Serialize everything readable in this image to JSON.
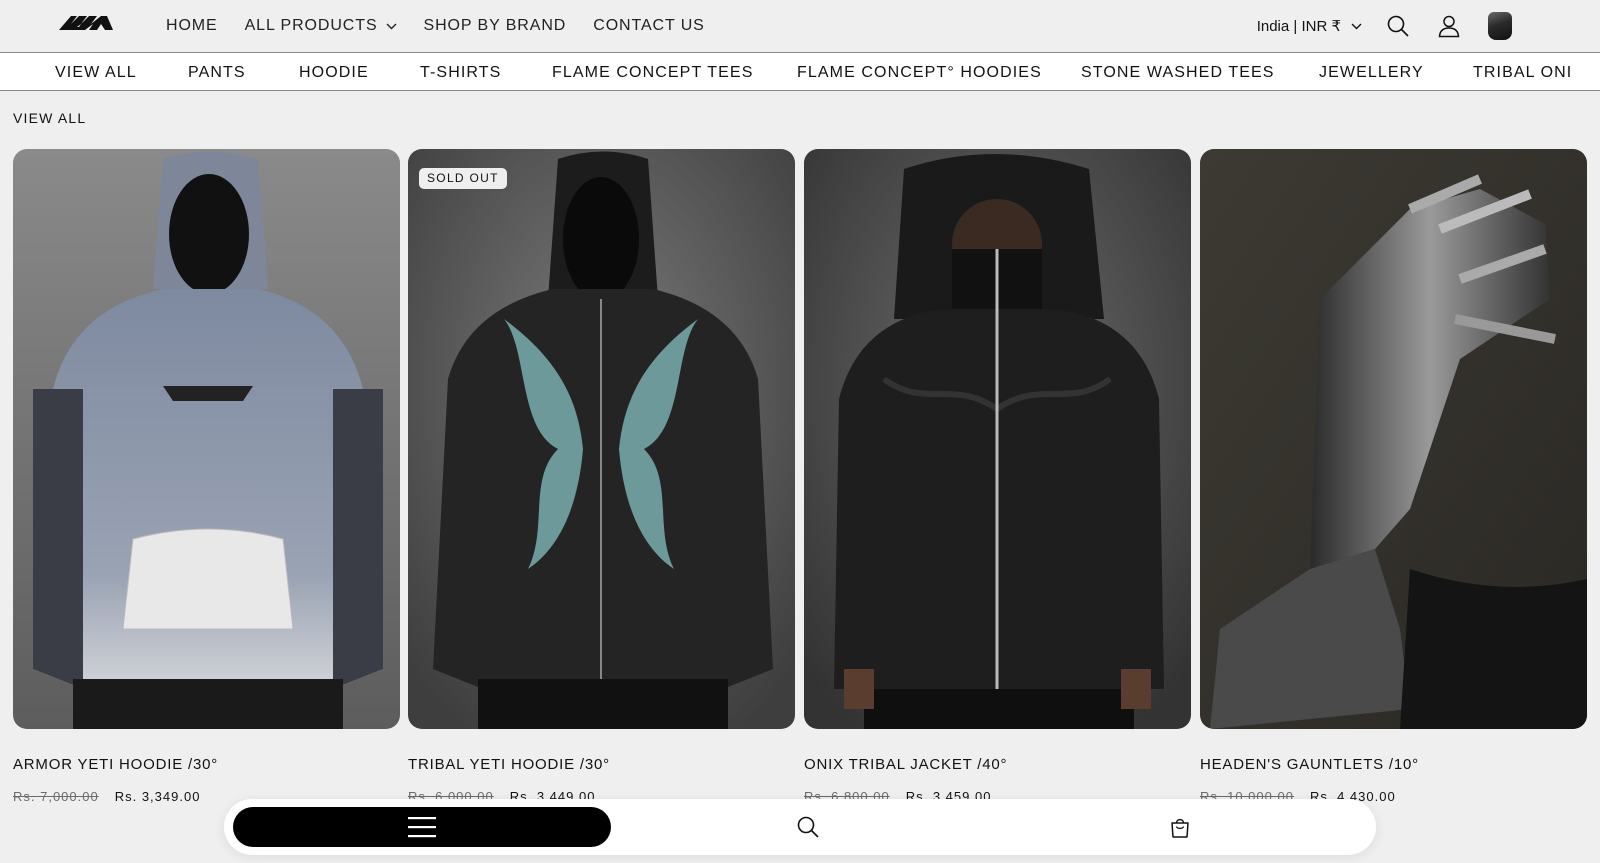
{
  "header": {
    "logo": "logo-icon",
    "nav": [
      {
        "label": "HOME"
      },
      {
        "label": "ALL PRODUCTS",
        "has_dropdown": true
      },
      {
        "label": "SHOP BY BRAND"
      },
      {
        "label": "CONTACT US"
      }
    ],
    "locale": "India | INR ₹",
    "icons": [
      "search-icon",
      "account-icon",
      "cart-icon"
    ]
  },
  "categories": [
    "VIEW ALL",
    "PANTS",
    "HOODIE",
    "T-SHIRTS",
    "FLAME CONCEPT TEES",
    "FLAME CONCEPT° HOODIES",
    "STONE WASHED TEES",
    "JEWELLERY",
    "TRIBAL ONI"
  ],
  "section_title": "VIEW ALL",
  "products": [
    {
      "title": "ARMOR YETI HOODIE /30°",
      "old_price": "Rs. 7,000.00",
      "new_price": "Rs. 3,349.00",
      "badge": ""
    },
    {
      "title": "TRIBAL YETI HOODIE /30°",
      "old_price": "Rs. 6,000.00",
      "new_price": "Rs. 3,449.00",
      "badge": "SOLD OUT"
    },
    {
      "title": "ONIX TRIBAL JACKET /40°",
      "old_price": "Rs. 6,800.00",
      "new_price": "Rs. 3,459.00",
      "badge": ""
    },
    {
      "title": "HEADEN'S GAUNTLETS /10°",
      "old_price": "Rs. 10,000.00",
      "new_price": "Rs. 4,430.00",
      "badge": ""
    }
  ],
  "bottom_bar": {
    "icons": [
      "menu-icon",
      "search-icon",
      "bag-icon"
    ]
  },
  "colors": {
    "background": "#efefef",
    "text": "#121212",
    "muted": "#6b6b6b",
    "menu_pill": "#000000"
  }
}
